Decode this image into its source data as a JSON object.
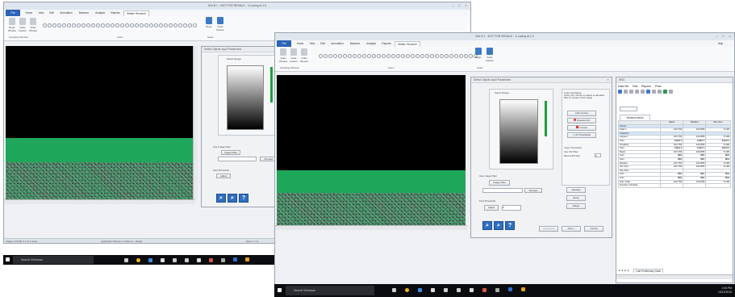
{
  "back_window": {
    "title": "Slot B 1 - NOT FOR RESALE - X-Lasing at 1.0",
    "tabs": [
      "Home",
      "View",
      "Edit",
      "Annotation",
      "Measure",
      "Analysis",
      "Reports",
      "Written Structure"
    ],
    "active_tab": "Written Structure",
    "file_tab": "File",
    "ribbon_group_1": "Sculpting Window",
    "ribbon_group_2": "Zoom",
    "ribbon_group_3": "Scale",
    "tool_1": "Begin Window",
    "tool_2": "Scale Feature",
    "tool_3": "Scale Window",
    "scale_tool_1": "Begin",
    "scale_tool_2": "Scale Feature",
    "status_left": "Image in Profile 4 1 of 1 done",
    "status_mid": "Application Shown in Output 1 - Ready",
    "status_right": "Zoom = 1.4"
  },
  "back_dialog": {
    "title": "Define Objects Input Parameters",
    "select_range": "Select Range",
    "use_image_filter": "Use Image Filter",
    "image_filter_btn": "Image Filter",
    "preview_btn": "Preview",
    "find_threshold": "Find Threshold",
    "auto_btn": "Adjust"
  },
  "front_window": {
    "title": "Slot B 1 - NOT FOR RESALE - X-Lasing at 1.0",
    "tabs": [
      "Home",
      "View",
      "Edit",
      "Annotation",
      "Measure",
      "Analysis",
      "Reports",
      "Written Structure"
    ],
    "active_tab": "Written Structure",
    "file_tab": "File",
    "ribbon_group_1": "Sculpting Window",
    "ribbon_group_2": "Zoom",
    "ribbon_group_3": "Scale",
    "tool_1": "Scale Window",
    "tool_2": "Scale Feature",
    "tool_3": "Scale Window",
    "scale_tool_1": "Begin",
    "scale_tool_2": "Scale Feature",
    "help": "Help"
  },
  "front_dialog": {
    "title": "Define Objects Input Parameters",
    "select_range": "Select Range",
    "color_averaging": "Color Averaging",
    "color_averaging_hint": "Click your mouse to select a standard filter to create a first image",
    "add_current": "Add Current",
    "deselect_all": "Deselect All",
    "current": "Current",
    "all_thresholds": "All Thresholds",
    "invert_threshold": "Invert Threshold",
    "use_filter": "Use Filt Filter",
    "mean_std_dev": "Mean+Std Dev",
    "mean_value": "2",
    "use_image_filter": "Use Image Filter",
    "image_filter_btn": "Image Filter",
    "preview_btn": "Preview",
    "find_threshold": "Find Threshold",
    "auto_btn": "Adjust",
    "auto_value": "0",
    "settings_btn": "Settings",
    "show_btn": "Show",
    "delete_btn": "Delete",
    "cancel_btn": "Cancel",
    "next_btn": "Next >",
    "back_btn": "Completed"
  },
  "measurements": {
    "title": "WSS",
    "menu": [
      "Data Set",
      "Edit",
      "Reports",
      "Plots"
    ],
    "tab": "Measurements",
    "columns": [
      "",
      "Mean",
      "Median",
      "Std. Dev."
    ],
    "rows": [
      {
        "label": "Whole",
        "values": [
          "",
          "",
          ""
        ],
        "hi": true
      },
      {
        "label": "Field 1",
        "values": [
          "100.766",
          "100.885",
          "5.198"
        ],
        "hi": false
      },
      {
        "label": "Statistics",
        "values": [
          "",
          "",
          ""
        ],
        "hi": true
      },
      {
        "label": "Largest",
        "values": [
          "100.766",
          "100.885",
          "5.198"
        ],
        "hi": false
      },
      {
        "label": "Sum",
        "values": [
          "Field 1",
          "Field 1",
          "Field 1"
        ],
        "hi": false,
        "bold": true
      },
      {
        "label": "Smallest",
        "values": [
          "100.766",
          "100.885",
          "5.198"
        ],
        "hi": false
      },
      {
        "label": "Sum",
        "values": [
          "Field 1",
          "Field 1",
          "Field 1"
        ],
        "hi": false,
        "bold": true
      },
      {
        "label": "Mean",
        "values": [
          "100.766",
          "100.885",
          "5.198"
        ],
        "hi": false
      },
      {
        "label": "Sum",
        "values": [
          "N/A",
          "N/A",
          "N/A"
        ],
        "hi": false,
        "bold": true
      },
      {
        "label": "Sum",
        "values": [
          "N/A",
          "N/A",
          "N/A"
        ],
        "hi": false,
        "bold": true
      },
      {
        "label": "Median",
        "values": [
          "100.766",
          "100.885",
          "5.198"
        ],
        "hi": false
      },
      {
        "label": "Std. Dev.",
        "values": [
          "100.766",
          "100.885",
          "5.198"
        ],
        "hi": false
      },
      {
        "label": "Std. Dev.",
        "values": [
          "",
          "",
          ""
        ],
        "hi": false
      },
      {
        "label": "Sum",
        "values": [
          "N/A",
          "N/A",
          "N/A"
        ],
        "hi": false,
        "bold": true
      },
      {
        "label": "Sum",
        "values": [
          "N/A",
          "N/A",
          "N/A"
        ],
        "hi": false,
        "bold": true
      },
      {
        "label": "Sum Total",
        "values": [
          "100.766",
          "100.885",
          "5.198"
        ],
        "hi": false
      },
      {
        "label": "Number of Fields",
        "values": [
          "",
          "",
          ""
        ],
        "hi": false
      }
    ],
    "sheet_tab": "Last Preliminary Data"
  },
  "taskbar": {
    "search_placeholder": "Search Windows",
    "time": "1:06 PM",
    "date": "10/12/2016"
  },
  "colors": {
    "accent": "#2b63b5",
    "green": "#1ea75a",
    "taskbar": "#0b0c0f"
  }
}
